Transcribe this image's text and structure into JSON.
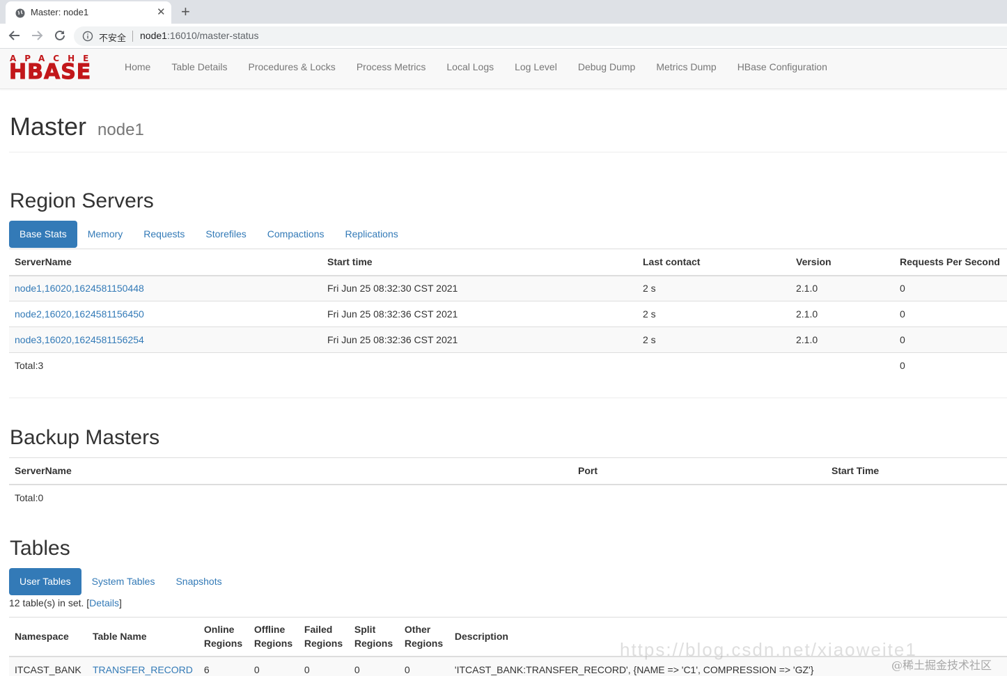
{
  "browser": {
    "tab_title": "Master: node1",
    "insecure_label": "不安全",
    "url_host": "node1",
    "url_path": ":16010/master-status"
  },
  "navbar": {
    "logo_top": "APACHE",
    "logo_main": "HBASE",
    "links": [
      "Home",
      "Table Details",
      "Procedures & Locks",
      "Process Metrics",
      "Local Logs",
      "Log Level",
      "Debug Dump",
      "Metrics Dump",
      "HBase Configuration"
    ]
  },
  "header": {
    "title": "Master",
    "subtitle": "node1"
  },
  "region_servers": {
    "heading": "Region Servers",
    "tabs": [
      "Base Stats",
      "Memory",
      "Requests",
      "Storefiles",
      "Compactions",
      "Replications"
    ],
    "active_tab": "Base Stats",
    "columns": [
      "ServerName",
      "Start time",
      "Last contact",
      "Version",
      "Requests Per Second"
    ],
    "rows": [
      [
        "node1,16020,1624581150448",
        "Fri Jun 25 08:32:30 CST 2021",
        "2 s",
        "2.1.0",
        "0"
      ],
      [
        "node2,16020,1624581156450",
        "Fri Jun 25 08:32:36 CST 2021",
        "2 s",
        "2.1.0",
        "0"
      ],
      [
        "node3,16020,1624581156254",
        "Fri Jun 25 08:32:36 CST 2021",
        "2 s",
        "2.1.0",
        "0"
      ]
    ],
    "total_label": "Total:3",
    "total_requests": "0"
  },
  "backup_masters": {
    "heading": "Backup Masters",
    "columns": [
      "ServerName",
      "Port",
      "Start Time"
    ],
    "total_label": "Total:0"
  },
  "tables": {
    "heading": "Tables",
    "tabs": [
      "User Tables",
      "System Tables",
      "Snapshots"
    ],
    "active_tab": "User Tables",
    "count_text": "12 table(s) in set. [",
    "details_link": "Details",
    "count_close": "]",
    "columns": [
      "Namespace",
      "Table Name",
      "Online Regions",
      "Offline Regions",
      "Failed Regions",
      "Split Regions",
      "Other Regions",
      "Description"
    ],
    "rows": [
      [
        "ITCAST_BANK",
        "TRANSFER_RECORD",
        "6",
        "0",
        "0",
        "0",
        "0",
        "'ITCAST_BANK:TRANSFER_RECORD', {NAME => 'C1', COMPRESSION => 'GZ'}"
      ]
    ]
  },
  "watermark": "@稀土掘金技术社区",
  "watermark_url": "https://blog.csdn.net/xiaoweite1"
}
